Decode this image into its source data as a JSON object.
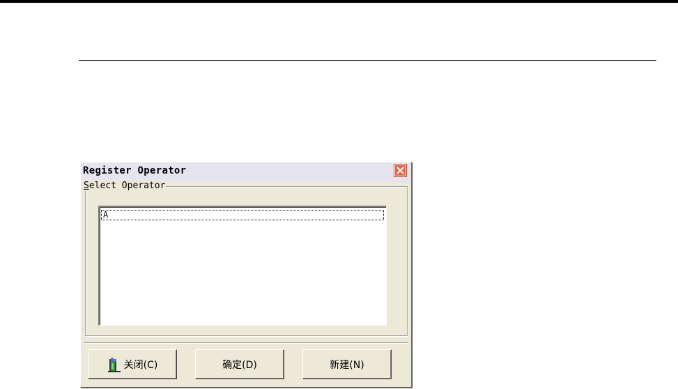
{
  "dialog": {
    "title": "Register Operator",
    "close_icon": "close-icon",
    "group_label_accel": "S",
    "group_label_rest": "elect Operator",
    "list_items": [
      "A"
    ],
    "buttons": {
      "close_label": "关闭(C)",
      "close_icon": "door-exit-icon",
      "ok_label": "确定(D)",
      "new_label": "新建(N)"
    }
  },
  "colors": {
    "dialog_bg": "#ece9d8",
    "titlebar_bg": "#e6e4ef",
    "close_button": "#e2664b"
  }
}
